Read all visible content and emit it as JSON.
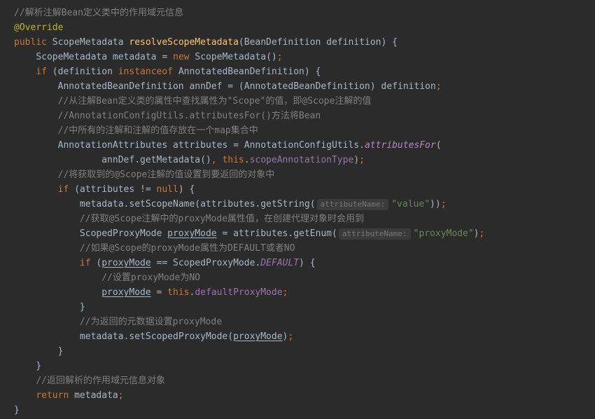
{
  "lines": {
    "c1": "//解析注解Bean定义类中的作用域元信息",
    "override": "@Override",
    "kw_public": "public",
    "ty_ScopeMetadata": "ScopeMetadata",
    "m_resolveScopeMetadata": "resolveScopeMetadata",
    "ty_BeanDefinition": "BeanDefinition",
    "p_definition": "definition",
    "v_metadata": "metadata",
    "kw_new": "new",
    "ctor_ScopeMetadata": "ScopeMetadata",
    "kw_if": "if",
    "kw_instanceof": "instanceof",
    "ty_AnnotatedBeanDefinition": "AnnotatedBeanDefinition",
    "v_annDef": "annDef",
    "c2": "//从注解Bean定义类的属性中查找属性为\"Scope\"的值，即@Scope注解的值",
    "c3": "//AnnotationConfigUtils.attributesFor()方法将Bean",
    "c4": "//中所有的注解和注解的值存放在一个map集合中",
    "ty_AnnotationAttributes": "AnnotationAttributes",
    "v_attributes": "attributes",
    "ty_AnnotationConfigUtils": "AnnotationConfigUtils",
    "m_attributesFor": "attributesFor",
    "m_getMetadata": "getMetadata",
    "kw_this": "this",
    "f_scopeAnnotationType": "scopeAnnotationType",
    "c5": "//将获取到的@Scope注解的值设置到要返回的对象中",
    "kw_null": "null",
    "m_setScopeName": "setScopeName",
    "m_getString": "getString",
    "hint_attributeName": "attributeName:",
    "s_value": "\"value\"",
    "c6": "//获取@Scope注解中的proxyMode属性值，在创建代理对象时会用到",
    "ty_ScopedProxyMode": "ScopedProxyMode",
    "v_proxyMode": "proxyMode",
    "m_getEnum": "getEnum",
    "s_proxyMode": "\"proxyMode\"",
    "c7": "//如果@Scope的proxyMode属性为DEFAULT或者NO",
    "const_DEFAULT": "DEFAULT",
    "c8": "//设置proxyMode为NO",
    "f_defaultProxyMode": "defaultProxyMode",
    "c9": "//为返回的元数据设置proxyMode",
    "m_setScopedProxyMode": "setScopedProxyMode",
    "c10": "//返回解析的作用域元信息对象",
    "kw_return": "return"
  }
}
